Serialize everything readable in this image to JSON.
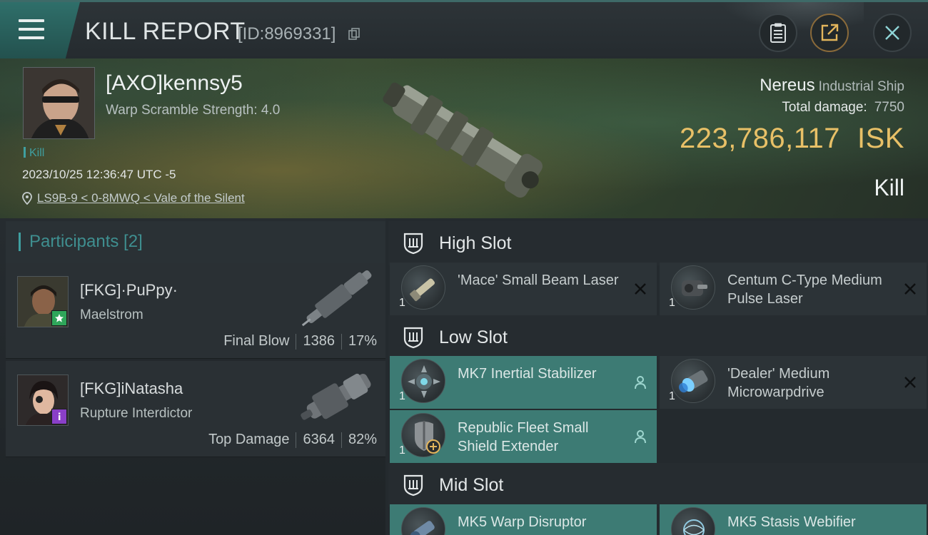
{
  "header": {
    "title": "KILL REPORT",
    "report_id": "[ID:8969331]"
  },
  "victim": {
    "name": "[AXO]kennsy5",
    "warp_scramble": "Warp Scramble Strength: 4.0",
    "tag": "Kill",
    "datetime": "2023/10/25 12:36:47 UTC -5",
    "location": "LS9B-9 < 0-8MWQ < Vale of the Silent",
    "ship_name": "Nereus",
    "ship_class": "Industrial Ship",
    "total_damage_label": "Total damage:",
    "total_damage_value": "7750",
    "isk_value": "223,786,117",
    "isk_unit": "ISK",
    "result": "Kill"
  },
  "participants": {
    "label": "Participants [2]",
    "items": [
      {
        "name": "[FKG]·PuPpy·",
        "ship": "Maelstrom",
        "role": "Final Blow",
        "damage": "1386",
        "percent": "17%",
        "badge_color": "#2fa65a",
        "badge_icon": "star-icon"
      },
      {
        "name": "[FKG]iNatasha",
        "ship": "Rupture Interdictor",
        "role": "Top Damage",
        "damage": "6364",
        "percent": "82%",
        "badge_color": "#8a3fc8",
        "badge_icon": "info-icon"
      }
    ]
  },
  "fitting": {
    "high_slot": {
      "label": "High Slot",
      "modules": [
        {
          "qty": "1",
          "name": "'Mace' Small Beam Laser",
          "state": "destroyed"
        },
        {
          "qty": "1",
          "name": "Centum C-Type Medium Pulse Laser",
          "state": "destroyed"
        }
      ]
    },
    "low_slot": {
      "label": "Low Slot",
      "modules": [
        {
          "qty": "1",
          "name": "MK7 Inertial Stabilizer",
          "state": "dropped"
        },
        {
          "qty": "1",
          "name": "'Dealer' Medium Microwarpdrive",
          "state": "destroyed"
        },
        {
          "qty": "1",
          "name": "Republic Fleet Small Shield Extender",
          "state": "dropped"
        }
      ]
    },
    "mid_slot": {
      "label": "Mid Slot",
      "modules": [
        {
          "qty": "1",
          "name": "MK5 Warp Disruptor",
          "state": "dropped"
        },
        {
          "qty": "1",
          "name": "MK5 Stasis Webifier",
          "state": "dropped"
        }
      ]
    }
  },
  "colors": {
    "accent": "#3f9fa0",
    "isk": "#e8c067",
    "dropped_bg": "#3d7b74",
    "destroyed_bg": "#2c3337"
  }
}
